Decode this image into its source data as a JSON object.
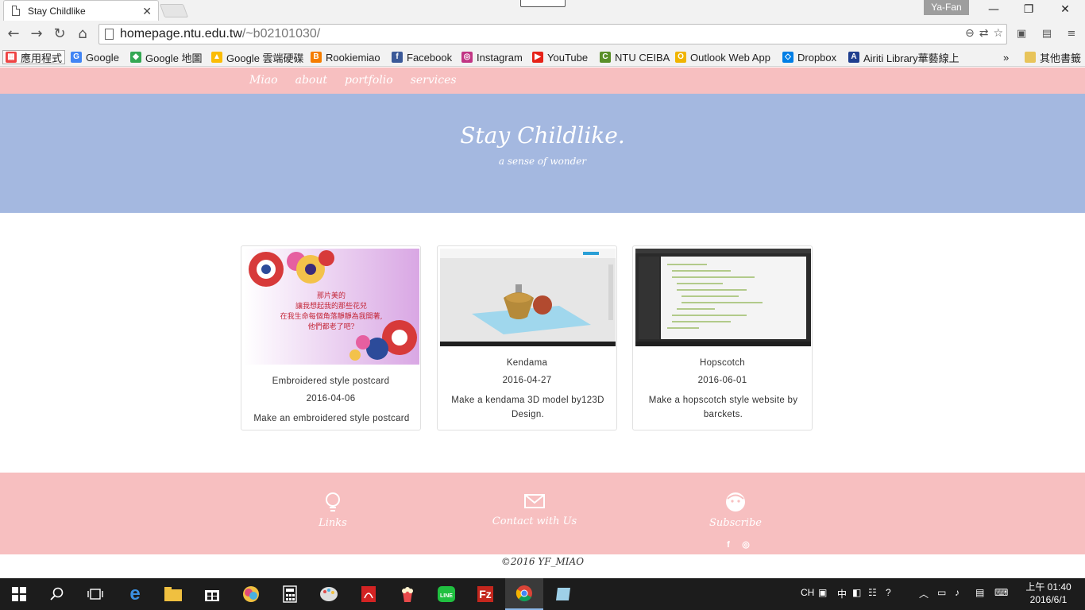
{
  "browser": {
    "tab_title": "Stay Childlike",
    "user": "Ya-Fan",
    "url_host": "homepage.ntu.edu.tw",
    "url_path": "/~b02101030/",
    "bookmarks": [
      {
        "label": "應用程式",
        "icon": "apps-grid-icon",
        "color": "#e44"
      },
      {
        "label": "Google",
        "icon": "google-icon",
        "color": "#4285f4"
      },
      {
        "label": "Google 地圖",
        "icon": "maps-icon",
        "color": "#34a853"
      },
      {
        "label": "Google 雲端硬碟",
        "icon": "drive-icon",
        "color": "#fbbc05"
      },
      {
        "label": "Rookiemiao",
        "icon": "blogger-icon",
        "color": "#f57d00"
      },
      {
        "label": "Facebook",
        "icon": "facebook-icon",
        "color": "#3b5998"
      },
      {
        "label": "Instagram",
        "icon": "instagram-icon",
        "color": "#c13584"
      },
      {
        "label": "YouTube",
        "icon": "youtube-icon",
        "color": "#e62117"
      },
      {
        "label": "NTU CEIBA",
        "icon": "ceiba-icon",
        "color": "#5a8f29"
      },
      {
        "label": "Outlook Web App",
        "icon": "outlook-icon",
        "color": "#f0b400"
      },
      {
        "label": "Dropbox",
        "icon": "dropbox-icon",
        "color": "#007ee5"
      },
      {
        "label": "Airiti Library華藝線上",
        "icon": "airiti-icon",
        "color": "#1f3f8f"
      },
      {
        "label": "其他書籤",
        "icon": "folder-icon",
        "color": "#e8c45a"
      }
    ]
  },
  "site": {
    "nav": [
      "Miao",
      "about",
      "portfolio",
      "services"
    ],
    "hero_title": "Stay Childlike.",
    "hero_subtitle": "a sense of wonder",
    "cards": [
      {
        "title": "Embroidered style postcard",
        "date": "2016-04-06",
        "desc": "Make an embroidered style postcard",
        "thumb_text": [
          "那片美的",
          "讓我想起我的那些花兒",
          "在我生命每個角落靜靜為我開著,",
          "他們都老了吧?"
        ]
      },
      {
        "title": "Kendama",
        "date": "2016-04-27",
        "desc": "Make a kendama 3D model by123D Design."
      },
      {
        "title": "Hopscotch",
        "date": "2016-06-01",
        "desc": "Make a hopscotch style website by barckets."
      }
    ],
    "footer": [
      {
        "label": "Links",
        "icon": "lightbulb-icon"
      },
      {
        "label": "Contact with Us",
        "icon": "envelope-icon"
      },
      {
        "label": "Subscribe",
        "icon": "face-icon"
      }
    ],
    "social": [
      "f",
      "◎"
    ],
    "copyright": "©2016 YF_MIAO"
  },
  "taskbar": {
    "ime": "CH",
    "ime2": "中",
    "time": "上午 01:40",
    "date": "2016/6/1"
  },
  "colors": {
    "pink": "#f7bfc0",
    "blue": "#a4b8e0"
  }
}
